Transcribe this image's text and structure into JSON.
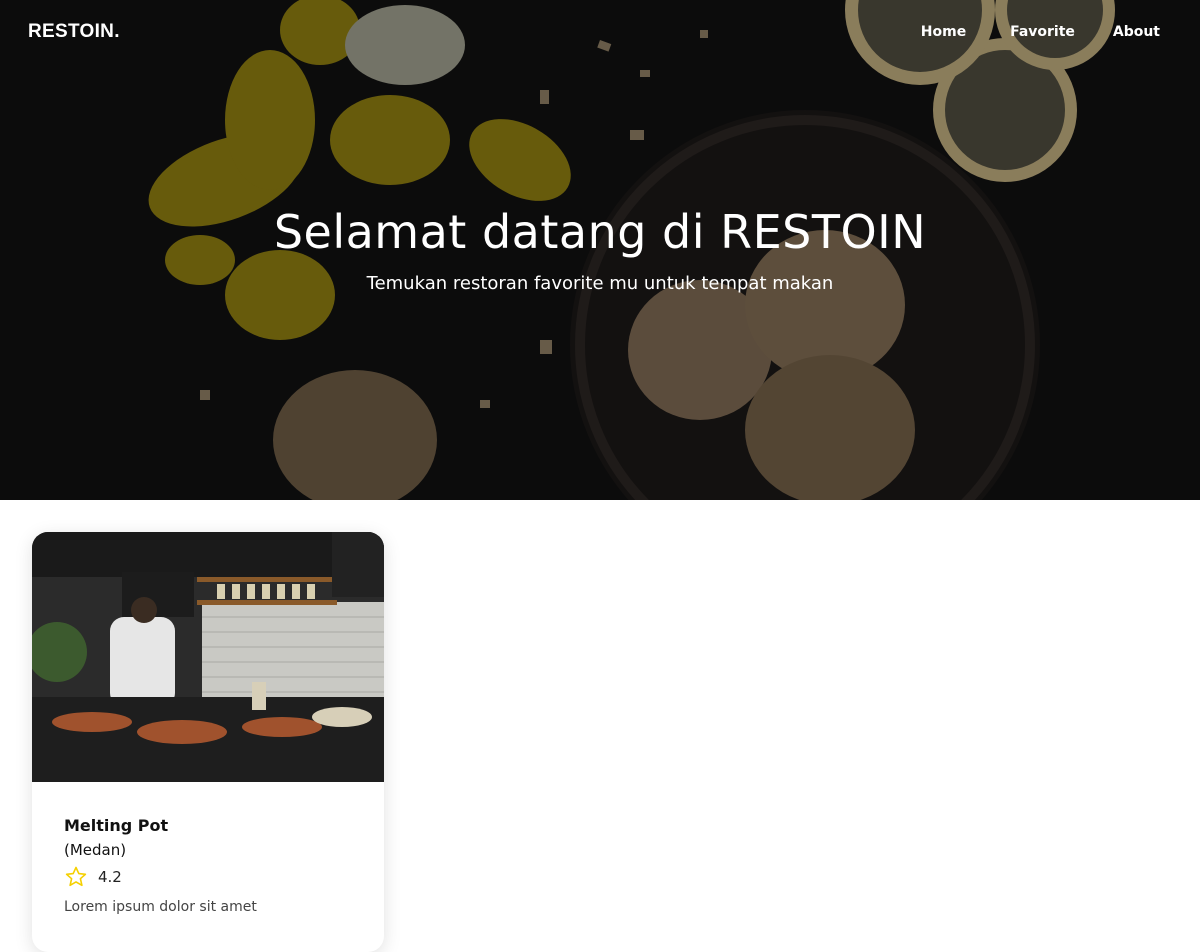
{
  "brand": "RESTOIN.",
  "nav": {
    "items": [
      {
        "label": "Home"
      },
      {
        "label": "Favorite"
      },
      {
        "label": "About"
      }
    ]
  },
  "hero": {
    "title": "Selamat datang di RESTOIN",
    "subtitle": "Temukan restoran favorite mu untuk tempat makan"
  },
  "restaurants": [
    {
      "name": "Melting Pot",
      "city": "(Medan)",
      "rating": "4.2",
      "description": "Lorem ipsum dolor sit amet"
    }
  ],
  "colors": {
    "star": "#f5d000",
    "hero_overlay": "#101010",
    "text_light": "#ffffff"
  },
  "icons": {
    "rating": "star-icon"
  }
}
